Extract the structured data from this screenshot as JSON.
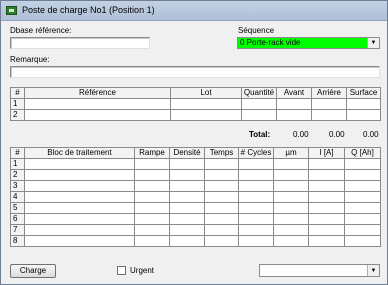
{
  "window": {
    "title": "Poste de charge No1 (Position 1)"
  },
  "form": {
    "dbase_label": "Dbase référence:",
    "dbase_value": "",
    "sequence_label": "Séquence",
    "sequence_value": "0 Porte-rack vide",
    "sequence_color": "#00ff00",
    "remarque_label": "Remarque:",
    "remarque_value": ""
  },
  "ref_table": {
    "headers": [
      "#",
      "Référence",
      "Lot",
      "Quantité",
      "Avant",
      "Arrière",
      "Surface"
    ],
    "rows": [
      [
        "1",
        "",
        "",
        "",
        "",
        "",
        ""
      ],
      [
        "2",
        "",
        "",
        "",
        "",
        "",
        ""
      ]
    ]
  },
  "totals": {
    "label": "Total:",
    "avant": "0.00",
    "arriere": "0.00",
    "surface": "0.00"
  },
  "bloc_table": {
    "headers": [
      "#",
      "Bloc de traitement",
      "Rampe",
      "Densité",
      "Temps",
      "# Cycles",
      "µm",
      "I [A]",
      "Q [Ah]"
    ],
    "rows": [
      [
        "1",
        "",
        "",
        "",
        "",
        "",
        "",
        "",
        ""
      ],
      [
        "2",
        "",
        "",
        "",
        "",
        "",
        "",
        "",
        ""
      ],
      [
        "3",
        "",
        "",
        "",
        "",
        "",
        "",
        "",
        ""
      ],
      [
        "4",
        "",
        "",
        "",
        "",
        "",
        "",
        "",
        ""
      ],
      [
        "5",
        "",
        "",
        "",
        "",
        "",
        "",
        "",
        ""
      ],
      [
        "6",
        "",
        "",
        "",
        "",
        "",
        "",
        "",
        ""
      ],
      [
        "7",
        "",
        "",
        "",
        "",
        "",
        "",
        "",
        ""
      ],
      [
        "8",
        "",
        "",
        "",
        "",
        "",
        "",
        "",
        ""
      ]
    ]
  },
  "footer": {
    "charge_label": "Charge",
    "urgent_label": "Urgent",
    "urgent_checked": false,
    "bottom_select_value": ""
  }
}
